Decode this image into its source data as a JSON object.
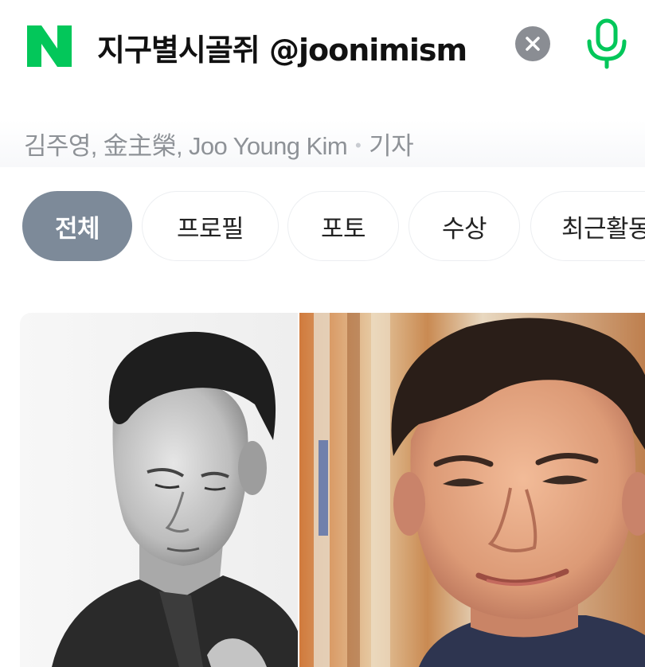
{
  "search": {
    "query": "지구별시골쥐 @joonimism",
    "logo_letter": "N",
    "brand_color": "#03c75a",
    "clear_icon": "close-icon",
    "mic_icon": "microphone-icon"
  },
  "profile": {
    "names": "김주영, 金主榮, Joo Young Kim",
    "separator": "•",
    "occupation": "기자"
  },
  "tabs": [
    {
      "label": "전체",
      "active": true
    },
    {
      "label": "프로필",
      "active": false
    },
    {
      "label": "포토",
      "active": false
    },
    {
      "label": "수상",
      "active": false
    },
    {
      "label": "최근활동",
      "active": false
    }
  ],
  "colors": {
    "active_tab": "#7d8a99",
    "subtitle_text": "#8e9297",
    "clear_button": "#8a8d93"
  },
  "photos": [
    {
      "name": "bw-portrait"
    },
    {
      "name": "color-portrait"
    }
  ]
}
